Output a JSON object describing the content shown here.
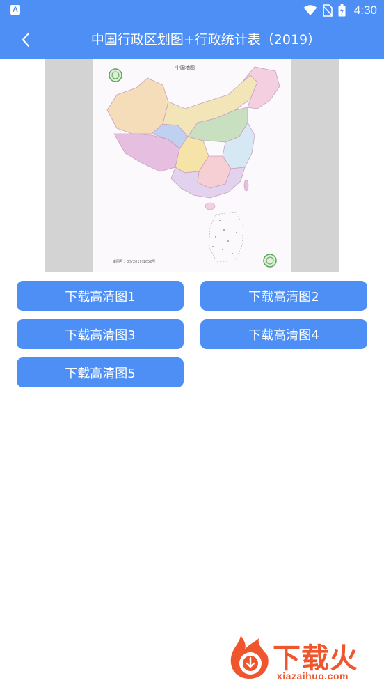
{
  "status_bar": {
    "app_icon_letter": "A",
    "time": "4:30",
    "icons": [
      "wifi-icon",
      "no-sim-icon",
      "battery-icon"
    ]
  },
  "app_bar": {
    "title": "中国行政区划图+行政统计表（2019）",
    "back_icon": "chevron-left-icon"
  },
  "map": {
    "title": "中国地图",
    "footer": "审图号：GS(2019)1652号"
  },
  "download_buttons": [
    {
      "label": "下载高清图1"
    },
    {
      "label": "下载高清图2"
    },
    {
      "label": "下载高清图3"
    },
    {
      "label": "下载高清图4"
    },
    {
      "label": "下载高清图5"
    }
  ],
  "watermark": {
    "brand": "下载火",
    "domain": "xiazaihuo.com"
  },
  "colors": {
    "primary": "#4d8ff5",
    "background": "#ffffff",
    "watermark": "#f0562e"
  }
}
